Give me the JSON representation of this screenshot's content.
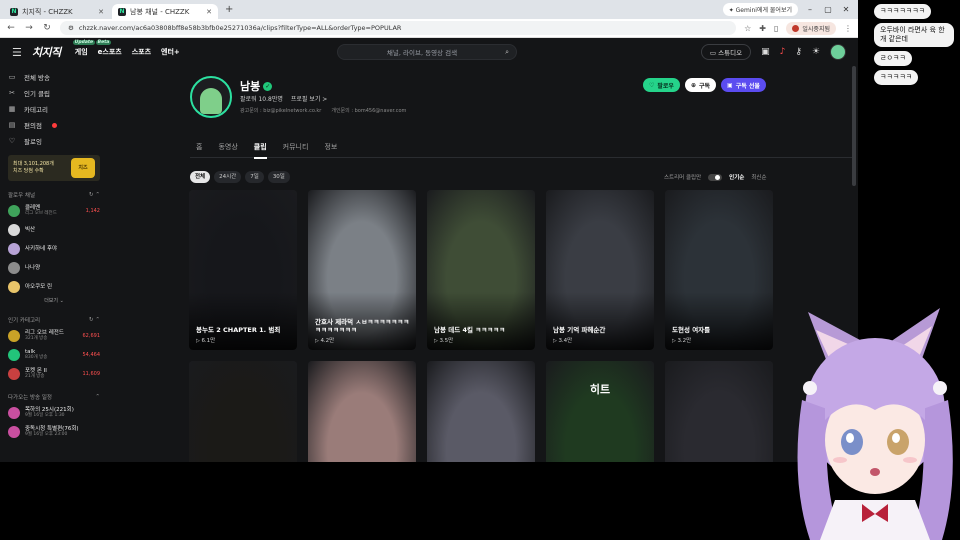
{
  "browser": {
    "tabs": [
      {
        "label": "치지직 - CHZZK",
        "active": false
      },
      {
        "label": "남봉 채널 - CHZZK",
        "active": true
      }
    ],
    "gemini_label": "Gemini에게 물어보기",
    "url": "chzzk.naver.com/ac6a03808bff8e58b3bfb0e25271036a/clips?filterType=ALL&orderType=POPULAR",
    "profile_label": "일시중지됨"
  },
  "header": {
    "logo": "치지직",
    "nav": [
      {
        "label": "게임",
        "badge": "Update"
      },
      {
        "label": "e스포츠",
        "badge": "Beta"
      },
      {
        "label": "스포츠",
        "badge": ""
      },
      {
        "label": "엔터+",
        "badge": ""
      }
    ],
    "search_placeholder": "채널, 라이브, 동영상 검색",
    "studio_label": "스튜디오"
  },
  "sidebar": {
    "menu": [
      {
        "label": "전체 방송",
        "icon": "tv-icon"
      },
      {
        "label": "인기 클립",
        "icon": "scissors-icon"
      },
      {
        "label": "카테고리",
        "icon": "grid-icon"
      },
      {
        "label": "편의점",
        "icon": "store-icon",
        "live": true
      },
      {
        "label": "팔로잉",
        "icon": "heart-icon"
      }
    ],
    "promo": {
      "line1": "최대 3,101,208개",
      "line2": "치즈 당첨 수확",
      "coin": "치즈"
    },
    "following_title": "팔로우 채널",
    "following": [
      {
        "name": "클레멘",
        "sub": "리그 오브 레전드",
        "count": "1,142",
        "color": "#3fa35b"
      },
      {
        "name": "빅산",
        "sub": "",
        "count": "",
        "color": "#d9d9d9"
      },
      {
        "name": "사키하네 후야",
        "sub": "",
        "count": "",
        "color": "#b7a3d6"
      },
      {
        "name": "나나양",
        "sub": "",
        "count": "",
        "color": "#8c8c8c"
      },
      {
        "name": "아오쿠모 린",
        "sub": "",
        "count": "",
        "color": "#e8c46a"
      }
    ],
    "more_label": "더보기",
    "popular_title": "인기 카테고리",
    "popular": [
      {
        "name": "리그 오브 레전드",
        "sub": "321개 방송",
        "count": "62,691",
        "color": "#c9a227"
      },
      {
        "name": "talk",
        "sub": "830개 방송",
        "count": "54,464",
        "color": "#22c47a"
      },
      {
        "name": "포켓 몬 II",
        "sub": "21개 방송",
        "count": "11,609",
        "color": "#c94040"
      }
    ],
    "upcoming_title": "다가오는 방송 일정",
    "upcoming": [
      {
        "name": "목하의 25시(221회)",
        "sub": "9월 16일 오후 1:30",
        "color": "#c94fa0"
      },
      {
        "name": "중독시청 특별편(76회)",
        "sub": "9월 16일 오후 23:00",
        "color": "#c94fa0"
      }
    ]
  },
  "channel": {
    "name": "남봉",
    "followers": "팔로워 10.8만명",
    "profile_link": "프로필 보기 >",
    "contact_biz": "광고문의 : biz@pikelnetwork.co.kr",
    "contact_personal": "개인문의 : bom456@naver.com",
    "actions": {
      "follow": "팔로우",
      "subscribe": "구독",
      "gift": "구독 선물"
    },
    "tabs": [
      {
        "label": "홈",
        "active": false
      },
      {
        "label": "동영상",
        "active": false
      },
      {
        "label": "클립",
        "active": true
      },
      {
        "label": "커뮤니티",
        "active": false
      },
      {
        "label": "정보",
        "active": false
      }
    ],
    "filters": [
      {
        "label": "전체",
        "active": true
      },
      {
        "label": "24시간",
        "active": false
      },
      {
        "label": "7일",
        "active": false
      },
      {
        "label": "30일",
        "active": false
      }
    ],
    "sorts": {
      "streamer_only": "스트리머 클립만",
      "popular": "인기순",
      "latest": "최신순"
    }
  },
  "clips": [
    {
      "title": "봉누도 2 CHAPTER 1. 범죄",
      "views": "6.1만",
      "theme": "#16171b"
    },
    {
      "title": "간호사 제라덕 ㅅㅂㅋㅋㅋㅋㅋㅋㅋㅋㅋㅋㅋㅋㅋㅋ",
      "views": "4.2만",
      "theme": "#7b8086"
    },
    {
      "title": "남봉 데드 4킬 ㅋㅋㅋㅋㅋ",
      "views": "3.5만",
      "theme": "#3f4d36"
    },
    {
      "title": "남봉 기억 파헤순간",
      "views": "3.4만",
      "theme": "#3a3d44"
    },
    {
      "title": "도현성 여자를",
      "views": "3.2만",
      "theme": "#2c3238"
    },
    {
      "title": "",
      "views": "",
      "theme": "#1b1a17"
    },
    {
      "title": "",
      "views": "",
      "theme": "#9a7c79"
    },
    {
      "title": "",
      "views": "",
      "theme": "#5a5a66"
    },
    {
      "title": "",
      "views": "",
      "theme": "#1f3a20",
      "overlay": "히트"
    },
    {
      "title": "",
      "views": "",
      "theme": "#2a2a30"
    }
  ],
  "chat": [
    "ㅋㅋㅋㅋㅋㅋㅋ",
    "오두바이 라면사 육 한개 같은데",
    "ㄹㅇㅋㅋ",
    "ㅋㅋㅋㅋㅋ"
  ]
}
